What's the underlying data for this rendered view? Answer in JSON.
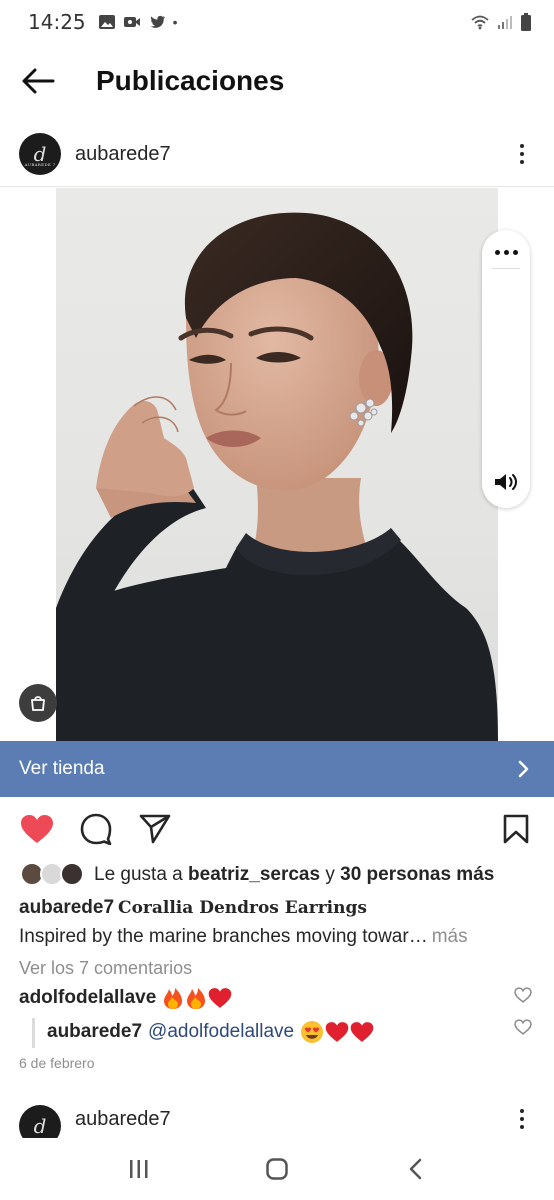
{
  "status_bar": {
    "time": "14:25",
    "dot": "•"
  },
  "header": {
    "title": "Publicaciones"
  },
  "post": {
    "username": "aubarede7",
    "avatar_letter": "d",
    "avatar_sub": "AUBAREDE 7",
    "shop_label": "Ver tienda",
    "likes_prefix": "Le gusta a",
    "likes_user": "beatriz_sercas",
    "likes_join": "y",
    "likes_others": "30 personas más",
    "caption_user": "aubarede7",
    "caption_title": "Corallia Dendros Earrings",
    "caption_text": "Inspired by the marine branches moving towar…",
    "caption_more": "más",
    "view_comments": "Ver los 7 comentarios",
    "comments": [
      {
        "user": "adolfodelallave",
        "text": "",
        "emoji": [
          "fire",
          "fire",
          "red-heart"
        ]
      },
      {
        "user": "aubarede7",
        "mention": "@adolfodelallave",
        "emoji": [
          "heart-eyes",
          "red-heart",
          "red-heart"
        ]
      }
    ],
    "date": "6 de febrero",
    "liked": true
  },
  "next_post": {
    "username": "aubarede7",
    "avatar_letter": "d"
  },
  "colors": {
    "shop_bar": "#5b7db3",
    "like_red": "#ed4956",
    "mention": "#2f4a7a"
  }
}
